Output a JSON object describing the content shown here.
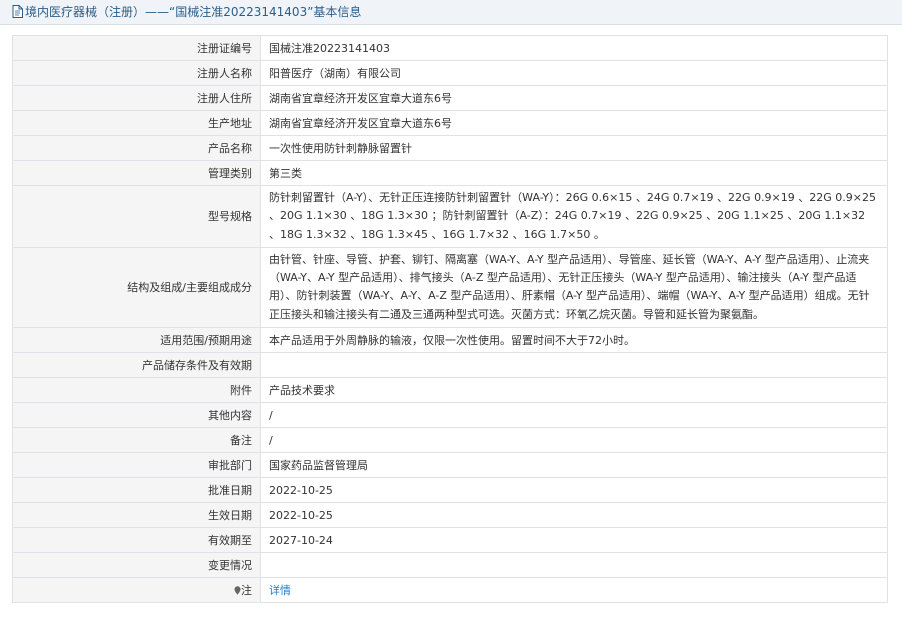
{
  "header": {
    "title": "境内医疗器械（注册）——“国械注准20223141403”基本信息"
  },
  "rows": [
    {
      "label": "注册证编号",
      "value": "国械注准20223141403"
    },
    {
      "label": "注册人名称",
      "value": "阳普医疗（湖南）有限公司"
    },
    {
      "label": "注册人住所",
      "value": "湖南省宜章经济开发区宜章大道东6号"
    },
    {
      "label": "生产地址",
      "value": "湖南省宜章经济开发区宜章大道东6号"
    },
    {
      "label": "产品名称",
      "value": "一次性使用防针刺静脉留置针"
    },
    {
      "label": "管理类别",
      "value": "第三类"
    },
    {
      "label": "型号规格",
      "value": "防针刺留置针（A-Y）、无针正压连接防针刺留置针（WA-Y）：26G 0.6×15 、24G 0.7×19 、22G 0.9×19 、22G 0.9×25 、20G 1.1×30 、18G 1.3×30 ；防针刺留置针（A-Z）：24G 0.7×19 、22G 0.9×25 、20G 1.1×25 、20G 1.1×32 、18G 1.3×32 、18G 1.3×45 、16G 1.7×32 、16G 1.7×50 。"
    },
    {
      "label": "结构及组成/主要组成成分",
      "value": "由针管、针座、导管、护套、铆钉、隔离塞（WA-Y、A-Y 型产品适用）、导管座、延长管（WA-Y、A-Y 型产品适用）、止流夹（WA-Y、A-Y 型产品适用）、排气接头（A-Z 型产品适用）、无针正压接头（WA-Y 型产品适用）、输注接头（A-Y 型产品适用）、防针刺装置（WA-Y、A-Y、A-Z 型产品适用）、肝素帽（A-Y 型产品适用）、端帽（WA-Y、A-Y 型产品适用）组成。无针正压接头和输注接头有二通及三通两种型式可选。灭菌方式：环氧乙烷灭菌。导管和延长管为聚氨酯。"
    },
    {
      "label": "适用范围/预期用途",
      "value": "本产品适用于外周静脉的输液，仅限一次性使用。留置时间不大于72小时。"
    },
    {
      "label": "产品储存条件及有效期",
      "value": ""
    },
    {
      "label": "附件",
      "value": "产品技术要求"
    },
    {
      "label": "其他内容",
      "value": "/"
    },
    {
      "label": "备注",
      "value": "/"
    },
    {
      "label": "审批部门",
      "value": "国家药品监督管理局"
    },
    {
      "label": "批准日期",
      "value": "2022-10-25"
    },
    {
      "label": "生效日期",
      "value": "2022-10-25"
    },
    {
      "label": "有效期至",
      "value": "2027-10-24"
    },
    {
      "label": "变更情况",
      "value": ""
    }
  ],
  "note_row": {
    "label": "注",
    "link_text": "详情",
    "icon": "pin-icon"
  },
  "colors": {
    "link": "#2a7bc1",
    "header_text": "#2b5d8a",
    "label_bg": "#f5f5f5",
    "border": "#dfe3e8"
  }
}
